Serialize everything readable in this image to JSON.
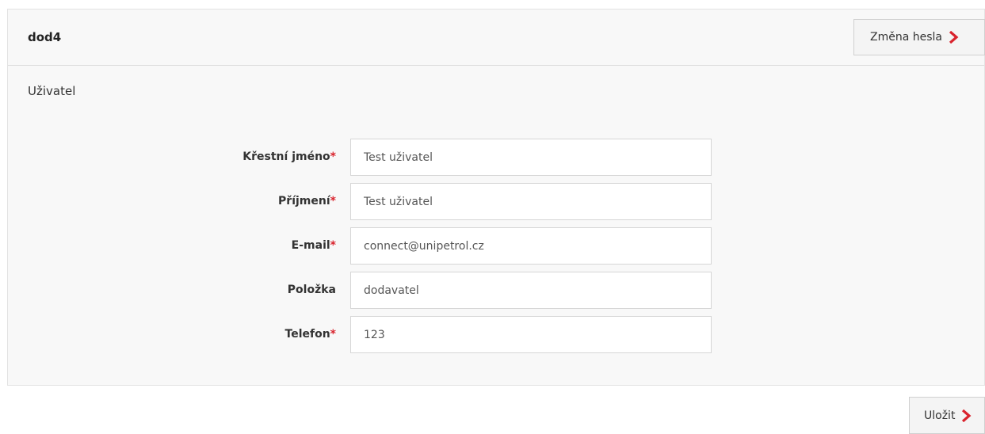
{
  "header": {
    "title": "dod4",
    "change_password_label": "Změna hesla"
  },
  "section": {
    "label": "Uživatel"
  },
  "form": {
    "fields": [
      {
        "label": "Křestní jméno",
        "required": "*",
        "value": "Test uživatel"
      },
      {
        "label": "Příjmení",
        "required": "*",
        "value": "Test uživatel"
      },
      {
        "label": "E-mail",
        "required": "*",
        "value": "connect@unipetrol.cz"
      },
      {
        "label": "Položka",
        "required": "",
        "value": "dodavatel"
      },
      {
        "label": "Telefon",
        "required": "*",
        "value": "123"
      }
    ]
  },
  "footer": {
    "save_label": "Uložit"
  },
  "icons": {
    "chevron": "chevron-right-icon"
  },
  "colors": {
    "accent": "#d9232d",
    "panel_bg": "#f8f8f8"
  }
}
